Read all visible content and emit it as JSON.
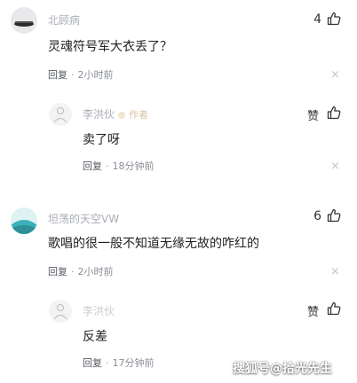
{
  "comments": [
    {
      "user": "北顾病",
      "text": "灵魂符号军大衣丢了？",
      "reply_label": "回复",
      "time": "2小时前",
      "likes": "4",
      "replies": [
        {
          "user": "李洪伙",
          "author_tag": "作者",
          "text": "卖了呀",
          "reply_label": "回复",
          "time": "18分钟前",
          "likes": "赞"
        }
      ]
    },
    {
      "user": "坦荡的天空VW",
      "text": "歌唱的很一般不知道无缘无故的咋红的",
      "reply_label": "回复",
      "time": "2小时前",
      "likes": "6",
      "replies": [
        {
          "user": "李洪伙",
          "text": "反差",
          "reply_label": "回复",
          "time": "17分钟前",
          "likes": "赞"
        }
      ]
    }
  ],
  "watermark": "搜狐号@拾光先生",
  "separator": "·",
  "close_glyph": "×"
}
